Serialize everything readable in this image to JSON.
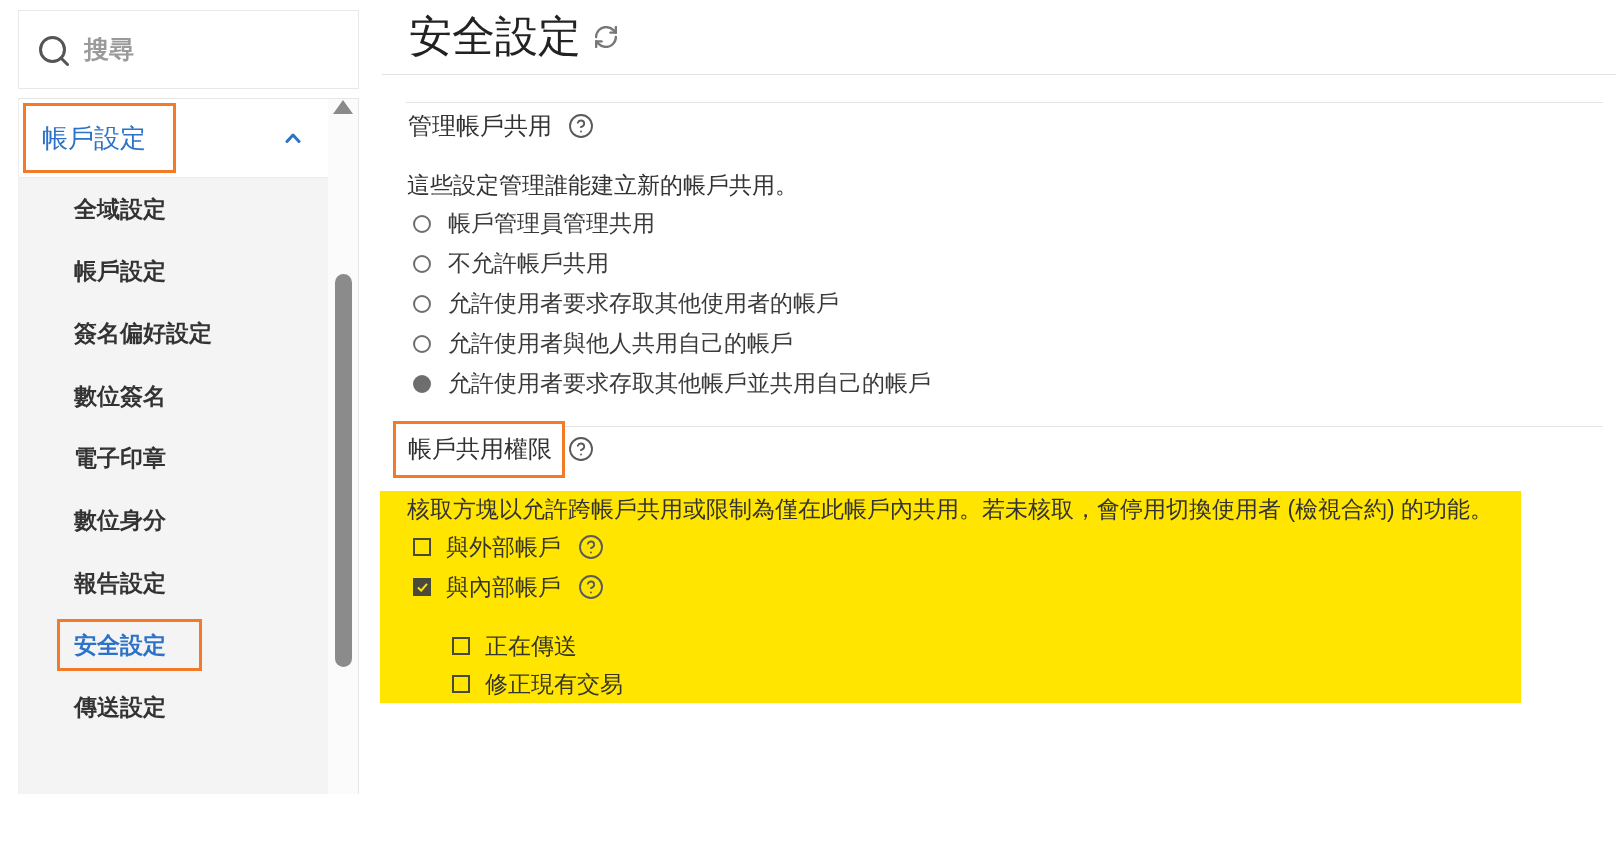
{
  "sidebar": {
    "search": {
      "placeholder": "搜尋"
    },
    "group": {
      "label": "帳戶設定",
      "expanded": true,
      "outlined": true,
      "items": [
        {
          "label": "全域設定",
          "selected": false,
          "outlined": false
        },
        {
          "label": "帳戶設定",
          "selected": false,
          "outlined": false
        },
        {
          "label": "簽名偏好設定",
          "selected": false,
          "outlined": false
        },
        {
          "label": "數位簽名",
          "selected": false,
          "outlined": false
        },
        {
          "label": "電子印章",
          "selected": false,
          "outlined": false
        },
        {
          "label": "數位身分",
          "selected": false,
          "outlined": false
        },
        {
          "label": "報告設定",
          "selected": false,
          "outlined": false
        },
        {
          "label": "安全設定",
          "selected": true,
          "outlined": true
        },
        {
          "label": "傳送設定",
          "selected": false,
          "outlined": false
        }
      ]
    }
  },
  "page": {
    "title": "安全設定"
  },
  "sections": [
    {
      "kind": "radio",
      "heading": "管理帳戶共用",
      "help": true,
      "outlined": false,
      "highlighted": false,
      "description": "這些設定管理誰能建立新的帳戶共用。",
      "options": [
        {
          "label": "帳戶管理員管理共用",
          "selected": false
        },
        {
          "label": "不允許帳戶共用",
          "selected": false
        },
        {
          "label": "允許使用者要求存取其他使用者的帳戶",
          "selected": false
        },
        {
          "label": "允許使用者與他人共用自己的帳戶",
          "selected": false
        },
        {
          "label": "允許使用者要求存取其他帳戶並共用自己的帳戶",
          "selected": true
        }
      ]
    },
    {
      "kind": "checkbox",
      "heading": "帳戶共用權限",
      "help": true,
      "outlined": true,
      "highlighted": true,
      "description": "核取方塊以允許跨帳戶共用或限制為僅在此帳戶內共用。若未核取，會停用切換使用者 (檢視合約) 的功能。",
      "options": [
        {
          "label": "與外部帳戶",
          "checked": false,
          "help": true
        },
        {
          "label": "與內部帳戶",
          "checked": true,
          "help": true,
          "children": [
            {
              "label": "正在傳送",
              "checked": false
            },
            {
              "label": "修正現有交易",
              "checked": false
            }
          ]
        }
      ]
    }
  ]
}
